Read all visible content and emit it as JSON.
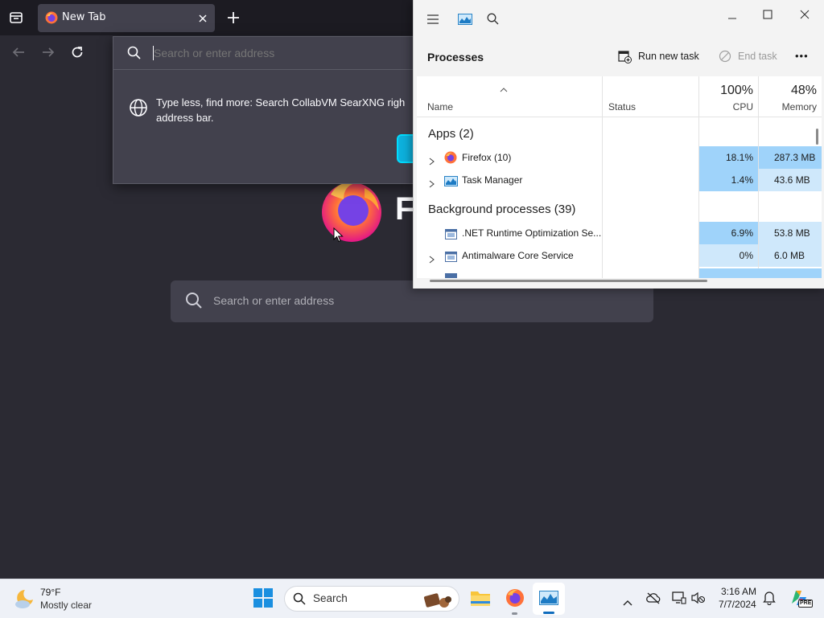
{
  "firefox": {
    "tab_title": "New Tab",
    "urlbar_placeholder": "Search or enter address",
    "popup_message_line1": "Type less, find more: Search CollabVM SearXNG righ",
    "popup_message_line2": "address bar.",
    "logo_partial_text": "F",
    "content_search_placeholder": "Search or enter address"
  },
  "task_manager": {
    "title_icon": "task-manager-icon",
    "section_title": "Processes",
    "run_new_task_label": "Run new task",
    "end_task_label": "End task",
    "more_label": "•••",
    "columns": {
      "name": "Name",
      "status": "Status",
      "cpu_percent": "100%",
      "cpu": "CPU",
      "memory_percent": "48%",
      "memory": "Memory"
    },
    "groups": {
      "apps": "Apps (2)",
      "background": "Background processes (39)"
    },
    "rows": [
      {
        "name": "Firefox (10)",
        "cpu": "18.1%",
        "memory": "287.3 MB",
        "icon": "firefox-icon",
        "expandable": true
      },
      {
        "name": "Task Manager",
        "cpu": "1.4%",
        "memory": "43.6 MB",
        "icon": "task-manager-icon",
        "expandable": true
      },
      {
        "name": ".NET Runtime Optimization Se...",
        "cpu": "6.9%",
        "memory": "53.8 MB",
        "icon": "service-window-icon",
        "expandable": false
      },
      {
        "name": "Antimalware Core Service",
        "cpu": "0%",
        "memory": "6.0 MB",
        "icon": "service-window-icon",
        "expandable": true
      }
    ],
    "colors": {
      "heat_high": "#9fd3fa",
      "heat_low": "#cfe8fb",
      "window_bg": "#f3f3f3"
    }
  },
  "taskbar": {
    "weather_temp": "79°F",
    "weather_desc": "Mostly clear",
    "search_label": "Search",
    "time": "3:16 AM",
    "date": "7/7/2024",
    "copilot_badge": "PRE"
  }
}
